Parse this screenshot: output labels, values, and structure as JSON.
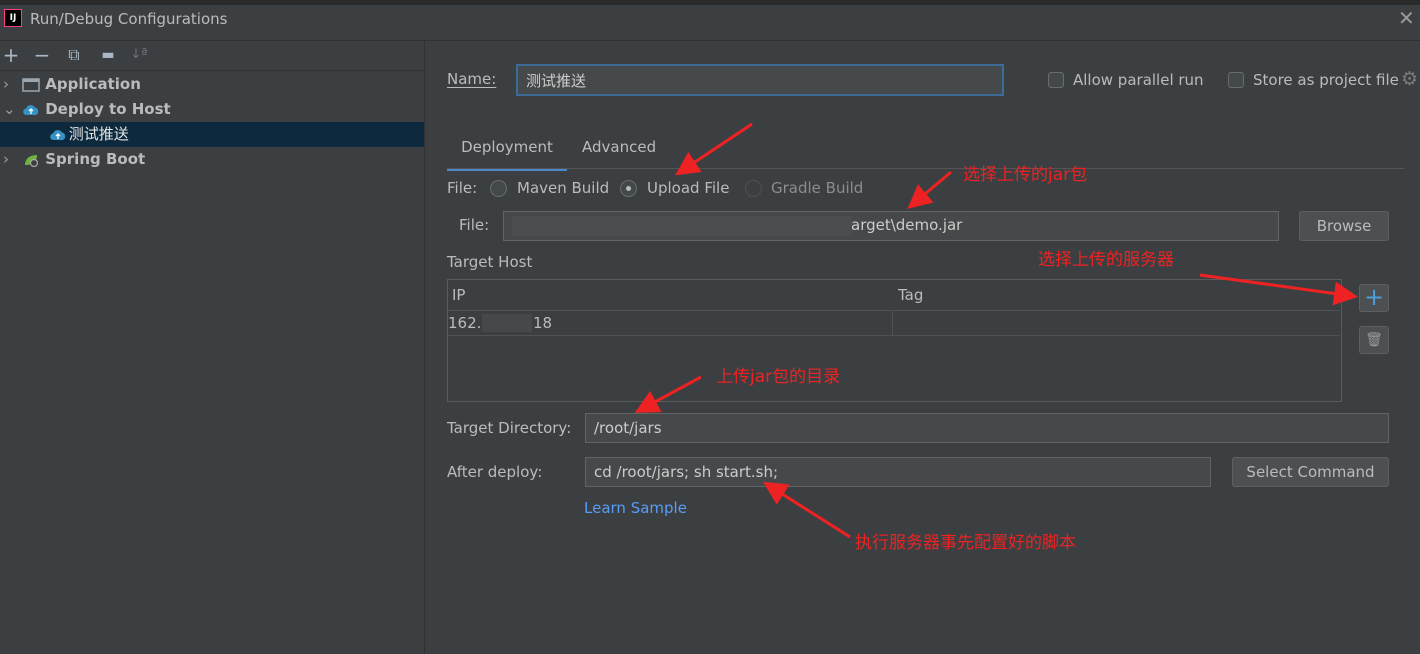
{
  "window": {
    "title": "Run/Debug Configurations",
    "app_icon": "IJ"
  },
  "toolbar": {
    "icons": [
      "add-icon",
      "remove-icon",
      "copy-icon",
      "folder-icon",
      "sort-icon"
    ],
    "glyphs": {
      "add": "+",
      "remove": "−",
      "copy": "⧉",
      "folder": "▬",
      "sort": "↓ª"
    }
  },
  "tree": [
    {
      "label": "Application",
      "expanded": false
    },
    {
      "label": "Deploy to Host",
      "expanded": true
    },
    {
      "label": "测试推送",
      "selected": true
    },
    {
      "label": "Spring Boot",
      "expanded": false
    }
  ],
  "name_row": {
    "label": "Name:",
    "value": "测试推送",
    "allow_parallel": "Allow parallel run",
    "store_project": "Store as project file"
  },
  "tabs": [
    {
      "label": "Deployment",
      "active": true
    },
    {
      "label": "Advanced",
      "active": false
    }
  ],
  "file_type": {
    "label": "File:",
    "options": [
      {
        "label": "Maven Build",
        "selected": false
      },
      {
        "label": "Upload File",
        "selected": true
      },
      {
        "label": "Gradle Build",
        "selected": false,
        "disabled": true
      }
    ]
  },
  "file_path": {
    "label": "File:",
    "value": "arget\\demo.jar",
    "browse": "Browse"
  },
  "target_host": {
    "label": "Target Host",
    "columns": [
      "IP",
      "Tag"
    ],
    "rows": [
      {
        "ip_prefix": "162.",
        "ip_suffix": "18",
        "tag": ""
      }
    ],
    "add_glyph": "+",
    "delete_glyph": "🗑"
  },
  "target_dir": {
    "label": "Target Directory:",
    "value": "/root/jars"
  },
  "after_deploy": {
    "label": "After deploy:",
    "value": "cd /root/jars; sh start.sh;",
    "select_command": "Select Command"
  },
  "learn_sample": "Learn Sample",
  "annotations": [
    "选择上传的jar包",
    "选择上传的服务器",
    "上传jar包的目录",
    "执行服务器事先配置好的脚本"
  ],
  "colors": {
    "accent": "#4a88c7",
    "link": "#589df6",
    "annotation": "#ee2222",
    "selection": "#0d293e"
  }
}
